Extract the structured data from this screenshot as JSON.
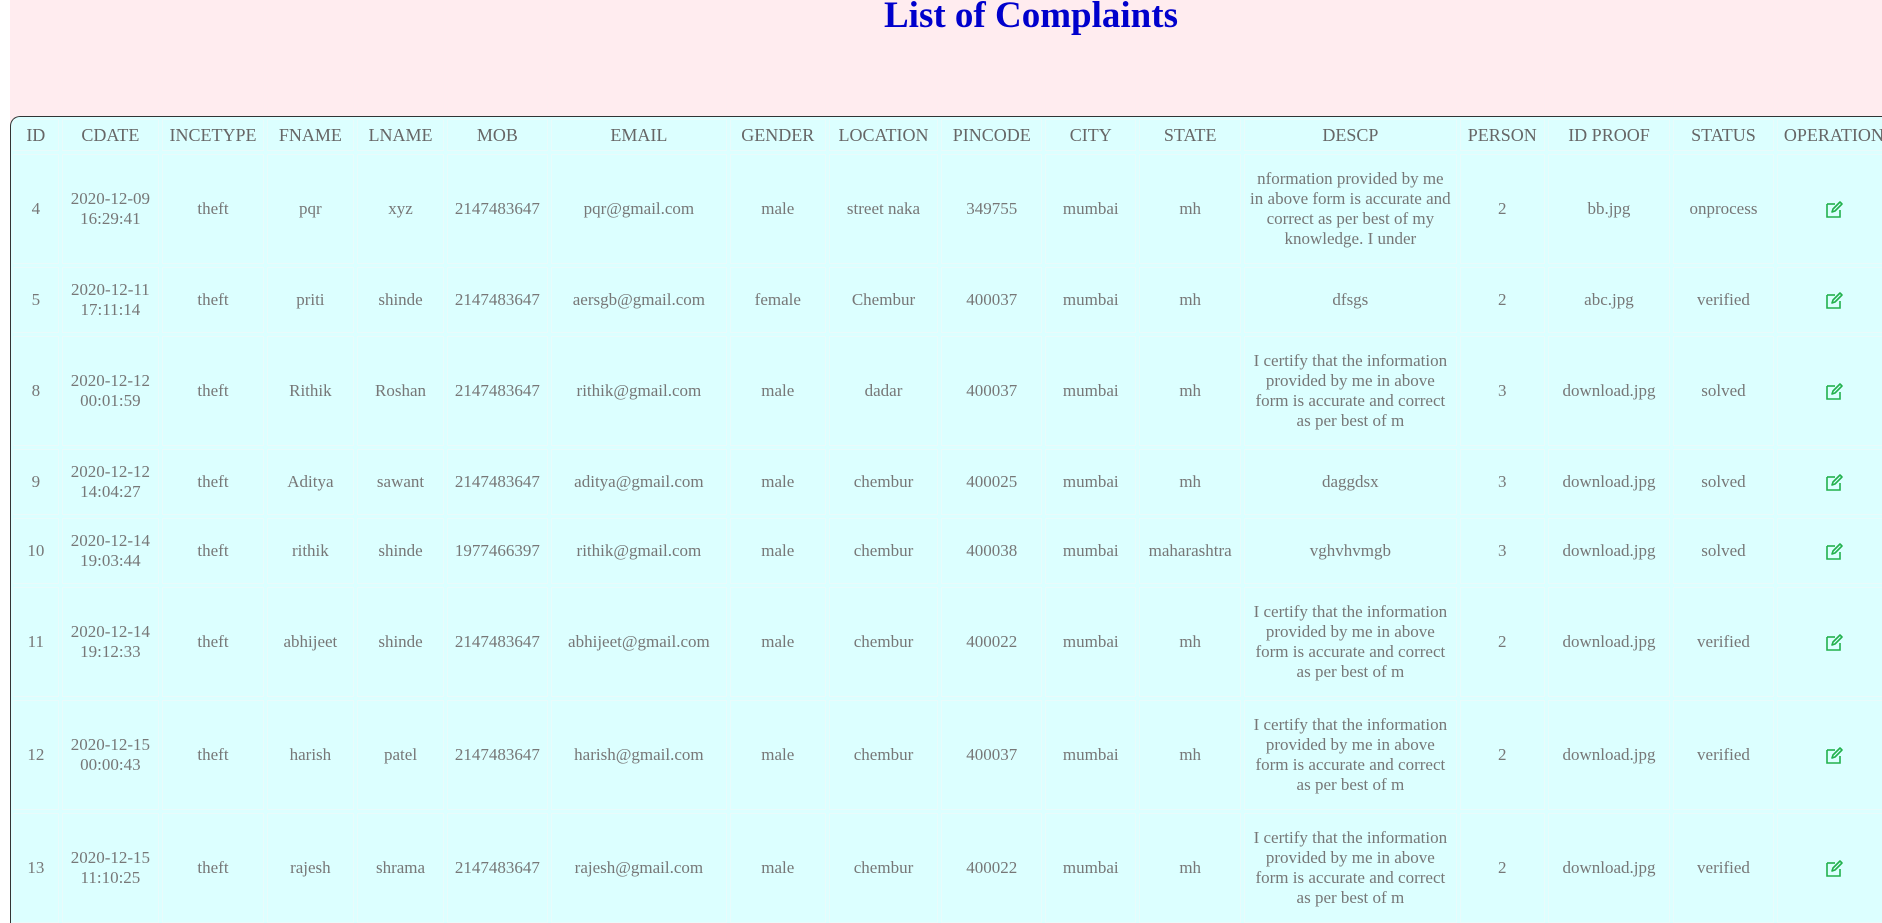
{
  "page": {
    "title": "List of Complaints"
  },
  "table": {
    "columns": [
      "ID",
      "CDATE",
      "INCETYPE",
      "FNAME",
      "LNAME",
      "MOB",
      "EMAIL",
      "GENDER",
      "LOCATION",
      "PINCODE",
      "CITY",
      "STATE",
      "DESCP",
      "PERSON",
      "ID PROOF",
      "STATUS",
      "OPERATION"
    ],
    "rows": [
      {
        "id": "4",
        "cdate_date": "2020-12-09",
        "cdate_time": "16:29:41",
        "incetype": "theft",
        "fname": "pqr",
        "lname": "xyz",
        "mob": "2147483647",
        "email": "pqr@gmail.com",
        "gender": "male",
        "location": "street naka",
        "pincode": "349755",
        "city": "mumbai",
        "state": "mh",
        "descp": "nformation provided by me in above form is accurate and correct as per best of my knowledge. I under",
        "person": "2",
        "idproof": "bb.jpg",
        "status": "onprocess",
        "operation_icon": "edit-icon"
      },
      {
        "id": "5",
        "cdate_date": "2020-12-11",
        "cdate_time": "17:11:14",
        "incetype": "theft",
        "fname": "priti",
        "lname": "shinde",
        "mob": "2147483647",
        "email": "aersgb@gmail.com",
        "gender": "female",
        "location": "Chembur",
        "pincode": "400037",
        "city": "mumbai",
        "state": "mh",
        "descp": "dfsgs",
        "person": "2",
        "idproof": "abc.jpg",
        "status": "verified",
        "operation_icon": "edit-icon"
      },
      {
        "id": "8",
        "cdate_date": "2020-12-12",
        "cdate_time": "00:01:59",
        "incetype": "theft",
        "fname": "Rithik",
        "lname": "Roshan",
        "mob": "2147483647",
        "email": "rithik@gmail.com",
        "gender": "male",
        "location": "dadar",
        "pincode": "400037",
        "city": "mumbai",
        "state": "mh",
        "descp": "I certify that the information provided by me in above form is accurate and correct as per best of m",
        "person": "3",
        "idproof": "download.jpg",
        "status": "solved",
        "operation_icon": "edit-icon"
      },
      {
        "id": "9",
        "cdate_date": "2020-12-12",
        "cdate_time": "14:04:27",
        "incetype": "theft",
        "fname": "Aditya",
        "lname": "sawant",
        "mob": "2147483647",
        "email": "aditya@gmail.com",
        "gender": "male",
        "location": "chembur",
        "pincode": "400025",
        "city": "mumbai",
        "state": "mh",
        "descp": "daggdsx",
        "person": "3",
        "idproof": "download.jpg",
        "status": "solved",
        "operation_icon": "edit-icon"
      },
      {
        "id": "10",
        "cdate_date": "2020-12-14",
        "cdate_time": "19:03:44",
        "incetype": "theft",
        "fname": "rithik",
        "lname": "shinde",
        "mob": "1977466397",
        "email": "rithik@gmail.com",
        "gender": "male",
        "location": "chembur",
        "pincode": "400038",
        "city": "mumbai",
        "state": "maharashtra",
        "descp": "vghvhvmgb",
        "person": "3",
        "idproof": "download.jpg",
        "status": "solved",
        "operation_icon": "edit-icon"
      },
      {
        "id": "11",
        "cdate_date": "2020-12-14",
        "cdate_time": "19:12:33",
        "incetype": "theft",
        "fname": "abhijeet",
        "lname": "shinde",
        "mob": "2147483647",
        "email": "abhijeet@gmail.com",
        "gender": "male",
        "location": "chembur",
        "pincode": "400022",
        "city": "mumbai",
        "state": "mh",
        "descp": "I certify that the information provided by me in above form is accurate and correct as per best of m",
        "person": "2",
        "idproof": "download.jpg",
        "status": "verified",
        "operation_icon": "edit-icon"
      },
      {
        "id": "12",
        "cdate_date": "2020-12-15",
        "cdate_time": "00:00:43",
        "incetype": "theft",
        "fname": "harish",
        "lname": "patel",
        "mob": "2147483647",
        "email": "harish@gmail.com",
        "gender": "male",
        "location": "chembur",
        "pincode": "400037",
        "city": "mumbai",
        "state": "mh",
        "descp": "I certify that the information provided by me in above form is accurate and correct as per best of m",
        "person": "2",
        "idproof": "download.jpg",
        "status": "verified",
        "operation_icon": "edit-icon"
      },
      {
        "id": "13",
        "cdate_date": "2020-12-15",
        "cdate_time": "11:10:25",
        "incetype": "theft",
        "fname": "rajesh",
        "lname": "shrama",
        "mob": "2147483647",
        "email": "rajesh@gmail.com",
        "gender": "male",
        "location": "chembur",
        "pincode": "400022",
        "city": "mumbai",
        "state": "mh",
        "descp": "I certify that the information provided by me in above form is accurate and correct as per best of m",
        "person": "2",
        "idproof": "download.jpg",
        "status": "verified",
        "operation_icon": "edit-icon"
      }
    ]
  },
  "colors": {
    "title": "#0000cc",
    "table_bg": "#dcffff",
    "page_bg": "#ffecef",
    "icon": "#22b14c"
  }
}
